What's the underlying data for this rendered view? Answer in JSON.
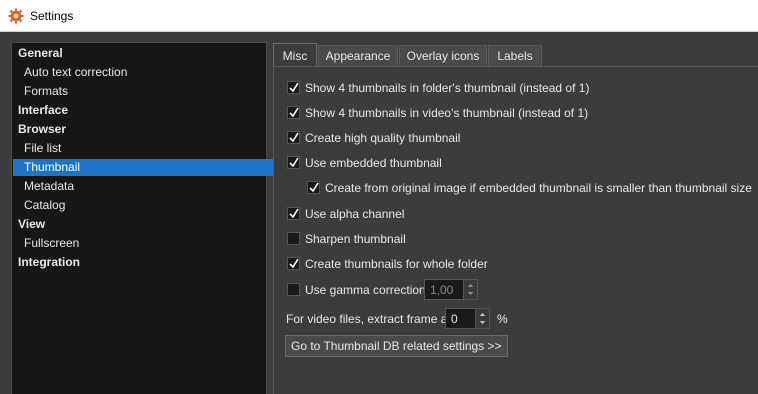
{
  "window": {
    "title": "Settings",
    "icon": "xnview-gear-icon"
  },
  "sidebar": {
    "items": [
      {
        "label": "General",
        "type": "header"
      },
      {
        "label": "Auto text correction",
        "type": "sub"
      },
      {
        "label": "Formats",
        "type": "sub"
      },
      {
        "label": "Interface",
        "type": "header"
      },
      {
        "label": "Browser",
        "type": "header"
      },
      {
        "label": "File list",
        "type": "sub"
      },
      {
        "label": "Thumbnail",
        "type": "sub",
        "selected": true
      },
      {
        "label": "Metadata",
        "type": "sub"
      },
      {
        "label": "Catalog",
        "type": "sub"
      },
      {
        "label": "View",
        "type": "header"
      },
      {
        "label": "Fullscreen",
        "type": "sub"
      },
      {
        "label": "Integration",
        "type": "header"
      }
    ]
  },
  "tabs": [
    {
      "label": "Misc",
      "active": true
    },
    {
      "label": "Appearance"
    },
    {
      "label": "Overlay icons"
    },
    {
      "label": "Labels"
    }
  ],
  "options": {
    "four_in_folder": {
      "label": "Show 4 thumbnails in folder's thumbnail (instead of 1)",
      "checked": true
    },
    "four_in_video": {
      "label": "Show 4 thumbnails in video's thumbnail (instead of 1)",
      "checked": true
    },
    "high_quality": {
      "label": "Create high quality thumbnail",
      "checked": true
    },
    "embedded": {
      "label": "Use embedded thumbnail",
      "checked": true
    },
    "from_original": {
      "label": "Create from original image if embedded thumbnail is smaller than thumbnail size",
      "checked": true
    },
    "alpha": {
      "label": "Use alpha channel",
      "checked": true
    },
    "sharpen": {
      "label": "Sharpen thumbnail",
      "checked": false
    },
    "whole_folder": {
      "label": "Create  thumbnails for whole folder",
      "checked": true
    },
    "gamma": {
      "label": "Use gamma correction",
      "checked": false,
      "value": "1,00"
    }
  },
  "video_frame": {
    "label": "For video files, extract frame at",
    "value": "0",
    "unit": "%"
  },
  "db_button": {
    "label": "Go to Thumbnail DB related settings >>"
  },
  "colors": {
    "selection": "#1e74c9",
    "background": "#3c3c3c",
    "sidebar_bg": "#161616"
  }
}
